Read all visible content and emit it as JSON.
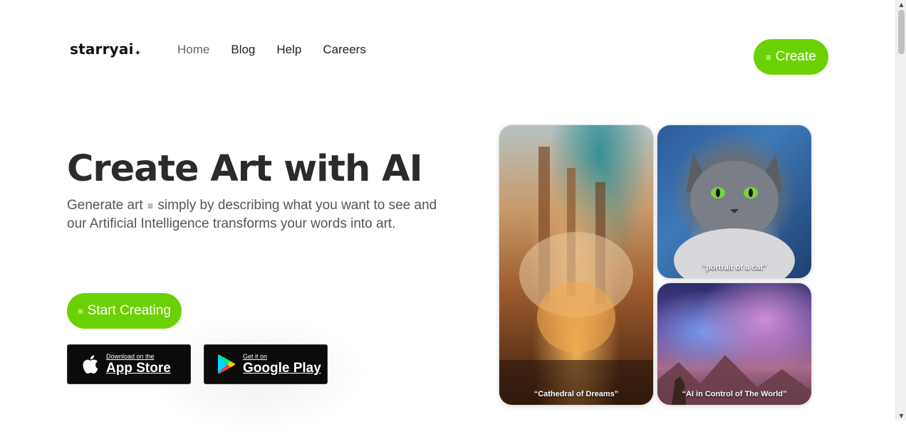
{
  "header": {
    "logo": "starryai",
    "logo_spark": "✦",
    "nav": [
      "Home",
      "Blog",
      "Help",
      "Careers"
    ],
    "create_label": "Create"
  },
  "hero": {
    "title": "Create Art with AI",
    "sub_part1": "Generate art",
    "sub_part2": "simply by describing what you want to see and our Artificial Intelligence transforms your words into art.",
    "start_label": "Start Creating"
  },
  "stores": {
    "apple_small": "Download on the",
    "apple_big": "App Store",
    "google_small": "Get it on",
    "google_big": "Google Play"
  },
  "gallery": [
    {
      "caption": "“Cathedral of Dreams”"
    },
    {
      "caption": "“portrait of a cat”"
    },
    {
      "caption": "“AI in Control of The World”"
    }
  ],
  "icons": {
    "menu": "≡",
    "scroll_up": "▲",
    "scroll_down": "▼"
  },
  "colors": {
    "accent": "#6cd104"
  }
}
